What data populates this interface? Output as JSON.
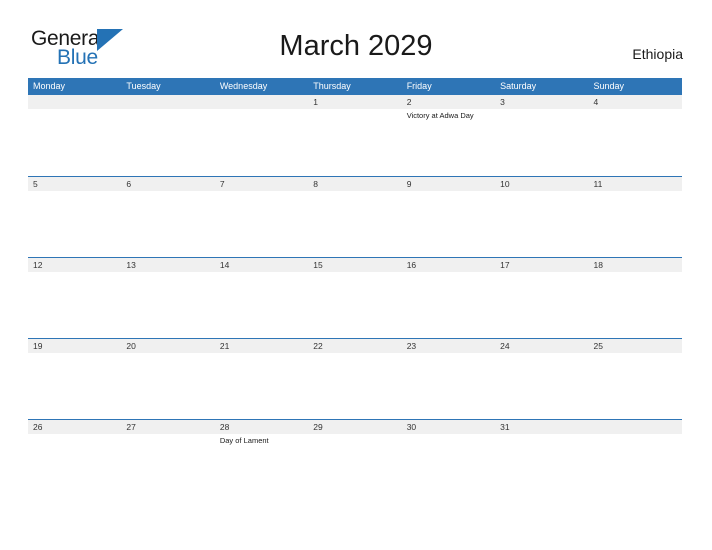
{
  "logo": {
    "word_one": "General",
    "word_two": "Blue",
    "triangle_icon": "triangle-icon",
    "accent_color": "#2472b5"
  },
  "header": {
    "title": "March 2029",
    "country": "Ethiopia",
    "header_bg_color": "#2e75b6",
    "date_strip_color": "#f0f0f0"
  },
  "calendar": {
    "weekdays": [
      "Monday",
      "Tuesday",
      "Wednesday",
      "Thursday",
      "Friday",
      "Saturday",
      "Sunday"
    ],
    "weeks": [
      [
        {
          "day": "",
          "events": []
        },
        {
          "day": "",
          "events": []
        },
        {
          "day": "",
          "events": []
        },
        {
          "day": "1",
          "events": []
        },
        {
          "day": "2",
          "events": [
            "Victory at Adwa Day"
          ]
        },
        {
          "day": "3",
          "events": []
        },
        {
          "day": "4",
          "events": []
        }
      ],
      [
        {
          "day": "5",
          "events": []
        },
        {
          "day": "6",
          "events": []
        },
        {
          "day": "7",
          "events": []
        },
        {
          "day": "8",
          "events": []
        },
        {
          "day": "9",
          "events": []
        },
        {
          "day": "10",
          "events": []
        },
        {
          "day": "11",
          "events": []
        }
      ],
      [
        {
          "day": "12",
          "events": []
        },
        {
          "day": "13",
          "events": []
        },
        {
          "day": "14",
          "events": []
        },
        {
          "day": "15",
          "events": []
        },
        {
          "day": "16",
          "events": []
        },
        {
          "day": "17",
          "events": []
        },
        {
          "day": "18",
          "events": []
        }
      ],
      [
        {
          "day": "19",
          "events": []
        },
        {
          "day": "20",
          "events": []
        },
        {
          "day": "21",
          "events": []
        },
        {
          "day": "22",
          "events": []
        },
        {
          "day": "23",
          "events": []
        },
        {
          "day": "24",
          "events": []
        },
        {
          "day": "25",
          "events": []
        }
      ],
      [
        {
          "day": "26",
          "events": []
        },
        {
          "day": "27",
          "events": []
        },
        {
          "day": "28",
          "events": [
            "Day of Lament"
          ]
        },
        {
          "day": "29",
          "events": []
        },
        {
          "day": "30",
          "events": []
        },
        {
          "day": "31",
          "events": []
        },
        {
          "day": "",
          "events": []
        }
      ]
    ]
  }
}
